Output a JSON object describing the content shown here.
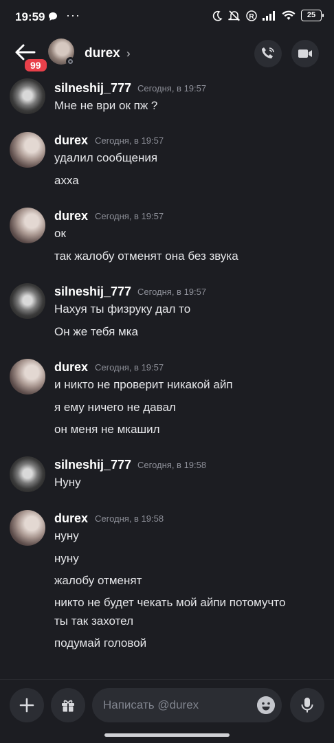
{
  "status_bar": {
    "time": "19:59",
    "dots": "···",
    "battery": "25"
  },
  "header": {
    "badge": "99",
    "name": "durex",
    "chevron": "›"
  },
  "messages": [
    {
      "author": "silneshij_777",
      "time": "Сегодня, в 19:57",
      "lines": [
        "Мне не ври ок пж ?"
      ]
    },
    {
      "author": "durex",
      "time": "Сегодня, в 19:57",
      "lines": [
        "удалил сообщения",
        "ахха"
      ]
    },
    {
      "author": "durex",
      "time": "Сегодня, в 19:57",
      "lines": [
        "ок",
        "так жалобу отменят она без звука"
      ]
    },
    {
      "author": "silneshij_777",
      "time": "Сегодня, в 19:57",
      "lines": [
        "Нахуя ты физруку дал то",
        "Он же тебя мка"
      ]
    },
    {
      "author": "durex",
      "time": "Сегодня, в 19:57",
      "lines": [
        "и никто не проверит никакой айп",
        "я ему ничего не давал",
        "он меня не мкашил"
      ]
    },
    {
      "author": "silneshij_777",
      "time": "Сегодня, в 19:58",
      "lines": [
        "Нуну"
      ]
    },
    {
      "author": "durex",
      "time": "Сегодня, в 19:58",
      "lines": [
        "нуну",
        "нуну",
        "жалобу отменят",
        "никто не будет чекать мой айпи потомучто",
        "ты так захотел",
        "подумай головой"
      ]
    }
  ],
  "composer": {
    "placeholder": "Написать @durex"
  }
}
